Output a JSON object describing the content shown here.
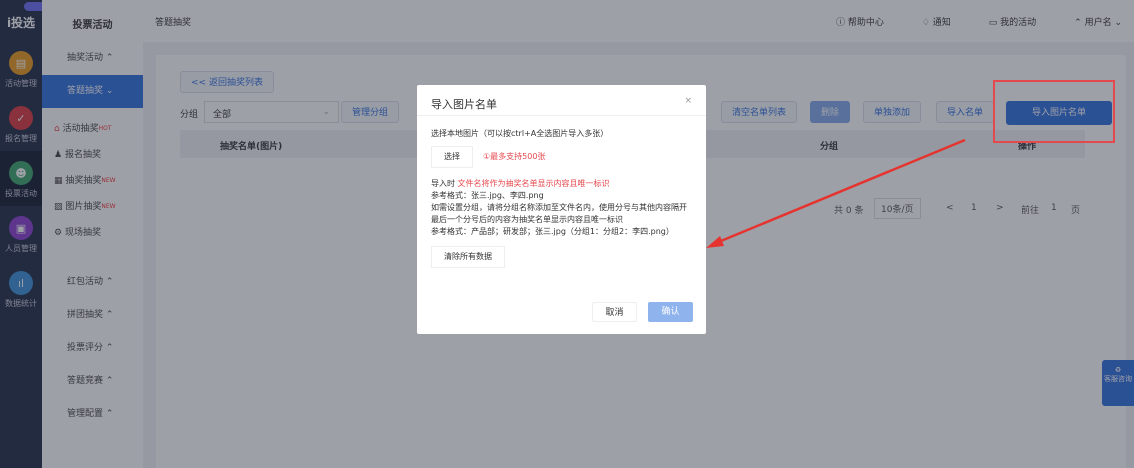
{
  "rail": {
    "logo": "i投选",
    "items": [
      "活动管理",
      "报名管理",
      "投票活动",
      "人员管理",
      "数据统计"
    ]
  },
  "menu": {
    "title": "投票活动",
    "groups": [
      "抽奖活动",
      "答题抽奖"
    ],
    "items": [
      {
        "label": "活动抽奖",
        "tag": "HOT"
      },
      {
        "label": "报名抽奖",
        "tag": ""
      },
      {
        "label": "抽奖抽奖",
        "tag": "NEW"
      },
      {
        "label": "图片抽奖",
        "tag": "NEW"
      },
      {
        "label": "现场抽奖",
        "tag": ""
      }
    ],
    "groups_after": [
      "红包活动",
      "拼团抽奖",
      "投票评分",
      "答题竞赛",
      "管理配置"
    ]
  },
  "topbar": {
    "breadcrumb": "答题抽奖",
    "help": "帮助中心",
    "notify": "通知",
    "console": "我的活动",
    "user": "用户名"
  },
  "main": {
    "back": "<< 返回抽奖列表",
    "group_label": "分组",
    "group_value": "全部",
    "manage_group": "管理分组",
    "buttons": [
      "清空名单列表",
      "删除",
      "单独添加",
      "导入名单",
      "导入图片名单"
    ],
    "table": {
      "headers": [
        "抽奖名单(图片)",
        "分组",
        "操作"
      ]
    },
    "pagination": {
      "total": "共 0 条",
      "per_page": "10条/页",
      "prev": "<",
      "page": "1",
      "next": ">",
      "goto": "前往",
      "goto_page": "1",
      "page_unit": "页"
    }
  },
  "modal": {
    "title": "导入图片名单",
    "close": "×",
    "hint": "选择本地图片（可以按ctrl+A全选图片导入多张）",
    "select": "选择",
    "select_note": "①最多支持500张",
    "line1_a": "导入时",
    "line1_b": "文件名将作为抽奖名单显示内容且唯一标识",
    "line2": "参考格式：张三.jpg、李四.png",
    "line3": "如需设置分组，请将分组名称添加至文件名内，使用分号与其他内容隔开",
    "line4": "最后一个分号后的内容为抽奖名单显示内容且唯一标识",
    "line5": "参考格式：产品部；研发部；张三.jpg（分组1：分组2：李四.png）",
    "clear": "清除所有数据",
    "cancel": "取消",
    "confirm": "确认"
  },
  "float": {
    "label": "客服咨询"
  }
}
